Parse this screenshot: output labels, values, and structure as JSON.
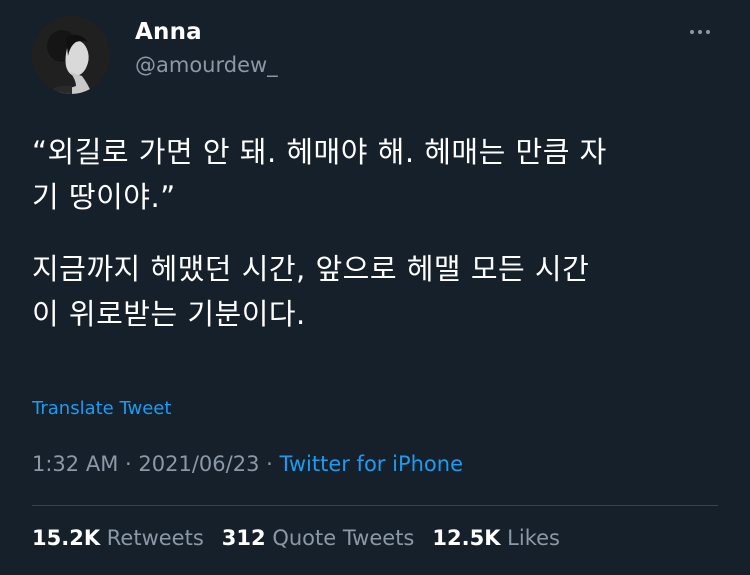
{
  "user": {
    "name": "Anna",
    "handle": "@amourdew_"
  },
  "tweet": {
    "paragraphs": [
      "“외길로 가면 안 돼. 헤매야 해. 헤매는 만큼 자\n기 땅이야.”",
      "지금까지 헤맸던 시간, 앞으로 헤맬 모든 시간\n이 위로받는 기분이다."
    ],
    "translate_label": "Translate Tweet",
    "time": "1:32 AM",
    "date": "2021/06/23",
    "separator": "·",
    "source": "Twitter for iPhone"
  },
  "stats": {
    "retweets_count": "15.2K",
    "retweets_label": "Retweets",
    "quotes_count": "312",
    "quotes_label": "Quote Tweets",
    "likes_count": "12.5K",
    "likes_label": "Likes"
  },
  "colors": {
    "background": "#15202b",
    "accent": "#1d9bf0",
    "secondary_text": "#8b98a5",
    "primary_text": "#ffffff",
    "divider": "#38444d"
  },
  "icons": {
    "more": "more-options-icon",
    "avatar": "avatar"
  }
}
